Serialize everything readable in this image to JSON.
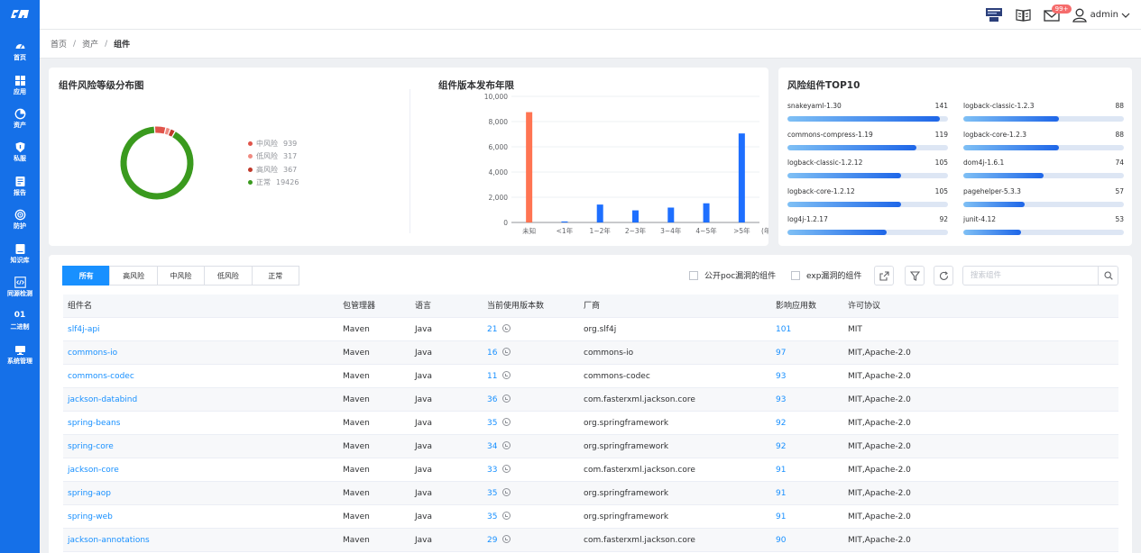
{
  "colors": {
    "primary": "#1570e8",
    "link": "#1890ff",
    "high": "#c0392b",
    "mid": "#e0544a",
    "low": "#f08a80",
    "normal": "#3a9a1e",
    "bar_unknown": "#ff7452",
    "bar": "#1e6fff"
  },
  "sidebar": {
    "items": [
      {
        "icon": "dashboard-icon",
        "label": "首页"
      },
      {
        "icon": "apps-icon",
        "label": "应用"
      },
      {
        "icon": "pie-icon",
        "label": "资产"
      },
      {
        "icon": "shield-icon",
        "label": "私服"
      },
      {
        "icon": "report-icon",
        "label": "报告"
      },
      {
        "icon": "target-icon",
        "label": "防护"
      },
      {
        "icon": "book-icon",
        "label": "知识库"
      },
      {
        "icon": "code-icon",
        "label": "同源检测"
      },
      {
        "icon": "binary-icon",
        "glyph": "01",
        "label": "二进制"
      },
      {
        "icon": "monitor-icon",
        "label": "系统管理"
      }
    ]
  },
  "header": {
    "badge": "99+",
    "username": "admin"
  },
  "breadcrumb": [
    "首页",
    "资产",
    "组件"
  ],
  "donut": {
    "title": "组件风险等级分布图",
    "legend": [
      {
        "label": "中风险",
        "value": 939,
        "color": "#e0544a"
      },
      {
        "label": "低风险",
        "value": 317,
        "color": "#f08a80"
      },
      {
        "label": "高风险",
        "value": 367,
        "color": "#c0392b"
      },
      {
        "label": "正常",
        "value": 19426,
        "color": "#3a9a1e"
      }
    ]
  },
  "chart_data": {
    "type": "bar",
    "title": "组件版本发布年限",
    "xlabel": "(年)",
    "ylabel": "",
    "categories": [
      "未知",
      "<1年",
      "1~2年",
      "2~3年",
      "3~4年",
      "4~5年",
      ">5年"
    ],
    "values": [
      8750,
      80,
      1420,
      960,
      1180,
      1520,
      7060
    ],
    "ylim": [
      0,
      10000
    ],
    "yticks": [
      "0",
      "2,000",
      "4,000",
      "6,000",
      "8,000",
      "10,000"
    ],
    "grid": true
  },
  "top10": {
    "title": "风险组件TOP10",
    "items": [
      {
        "name": "snakeyaml-1.30",
        "value": 141
      },
      {
        "name": "logback-classic-1.2.3",
        "value": 88
      },
      {
        "name": "commons-compress-1.19",
        "value": 119
      },
      {
        "name": "logback-core-1.2.3",
        "value": 88
      },
      {
        "name": "logback-classic-1.2.12",
        "value": 105
      },
      {
        "name": "dom4j-1.6.1",
        "value": 74
      },
      {
        "name": "logback-core-1.2.12",
        "value": 105
      },
      {
        "name": "pagehelper-5.3.3",
        "value": 57
      },
      {
        "name": "log4j-1.2.17",
        "value": 92
      },
      {
        "name": "junit-4.12",
        "value": 53
      }
    ]
  },
  "filters": {
    "tabs": [
      "所有",
      "高风险",
      "中风险",
      "低风险",
      "正常"
    ],
    "poc_label": "公开poc漏洞的组件",
    "exp_label": "exp漏洞的组件",
    "search_placeholder": "搜索组件"
  },
  "table": {
    "columns": [
      "组件名",
      "包管理器",
      "语言",
      "当前使用版本数",
      "厂商",
      "影响应用数",
      "许可协议"
    ],
    "rows": [
      [
        "slf4j-api",
        "Maven",
        "Java",
        "21",
        "org.slf4j",
        "101",
        "MIT"
      ],
      [
        "commons-io",
        "Maven",
        "Java",
        "16",
        "commons-io",
        "97",
        "MIT,Apache-2.0"
      ],
      [
        "commons-codec",
        "Maven",
        "Java",
        "11",
        "commons-codec",
        "93",
        "MIT,Apache-2.0"
      ],
      [
        "jackson-databind",
        "Maven",
        "Java",
        "36",
        "com.fasterxml.jackson.core",
        "93",
        "MIT,Apache-2.0"
      ],
      [
        "spring-beans",
        "Maven",
        "Java",
        "35",
        "org.springframework",
        "92",
        "MIT,Apache-2.0"
      ],
      [
        "spring-core",
        "Maven",
        "Java",
        "34",
        "org.springframework",
        "92",
        "MIT,Apache-2.0"
      ],
      [
        "jackson-core",
        "Maven",
        "Java",
        "33",
        "com.fasterxml.jackson.core",
        "91",
        "MIT,Apache-2.0"
      ],
      [
        "spring-aop",
        "Maven",
        "Java",
        "35",
        "org.springframework",
        "91",
        "MIT,Apache-2.0"
      ],
      [
        "spring-web",
        "Maven",
        "Java",
        "35",
        "org.springframework",
        "91",
        "MIT,Apache-2.0"
      ],
      [
        "jackson-annotations",
        "Maven",
        "Java",
        "29",
        "com.fasterxml.jackson.core",
        "90",
        "MIT,Apache-2.0"
      ]
    ]
  }
}
